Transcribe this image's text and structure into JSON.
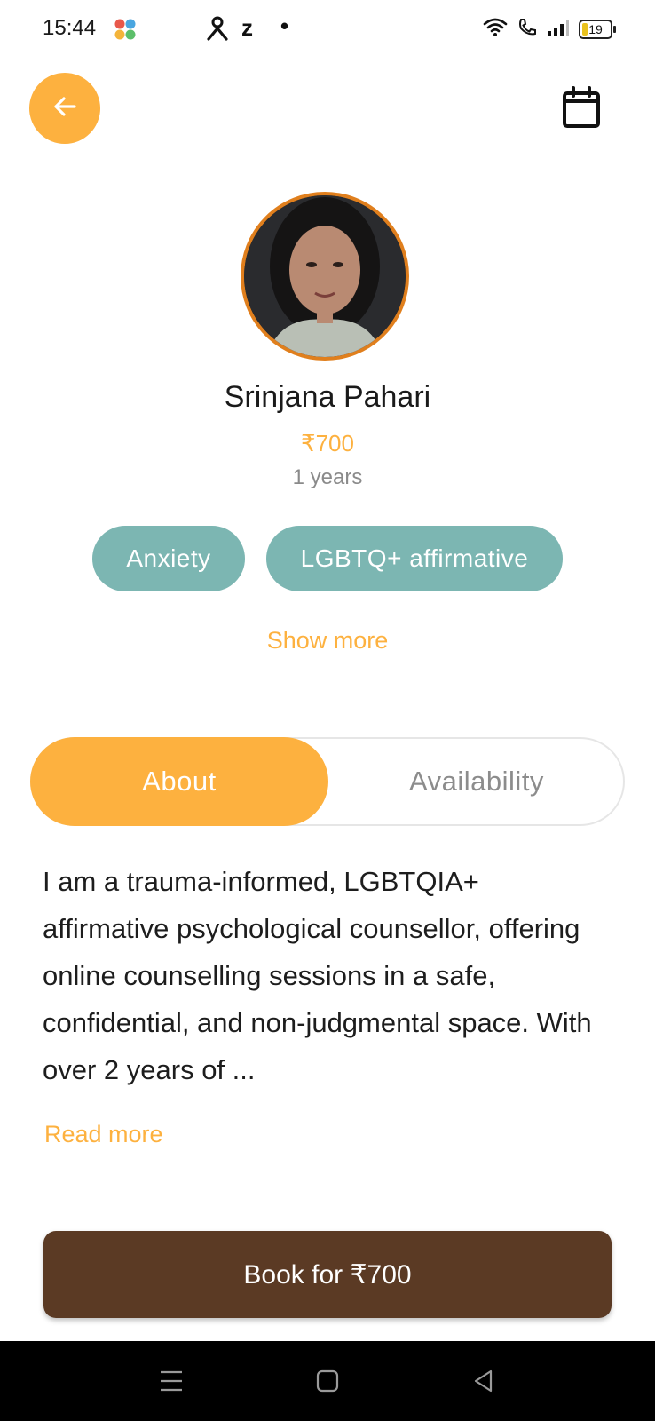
{
  "status_bar": {
    "time": "15:44",
    "notif_z": "z",
    "notif_dot": "•",
    "battery": "19"
  },
  "header": {
    "back_icon": "arrow-left-icon",
    "calendar_icon": "calendar-icon"
  },
  "profile": {
    "name": "Srinjana Pahari",
    "price": "₹700",
    "experience": "1 years",
    "tags": [
      "Anxiety",
      "LGBTQ+ affirmative"
    ],
    "show_more": "Show more"
  },
  "tabs": {
    "about": "About",
    "availability": "Availability",
    "active": "About"
  },
  "about": {
    "text": "I am a trauma-informed, LGBTQIA+ affirmative psychological counsellor, offering online counselling sessions in a safe, confidential, and non-judgmental space. With over 2 years of ...",
    "read_more": "Read more"
  },
  "cta": {
    "book_label": "Book for ₹700"
  },
  "colors": {
    "accent": "#fdb13f",
    "tag": "#7cb6b2",
    "cta": "#5b3a24",
    "avatar_ring": "#e07f1d"
  }
}
